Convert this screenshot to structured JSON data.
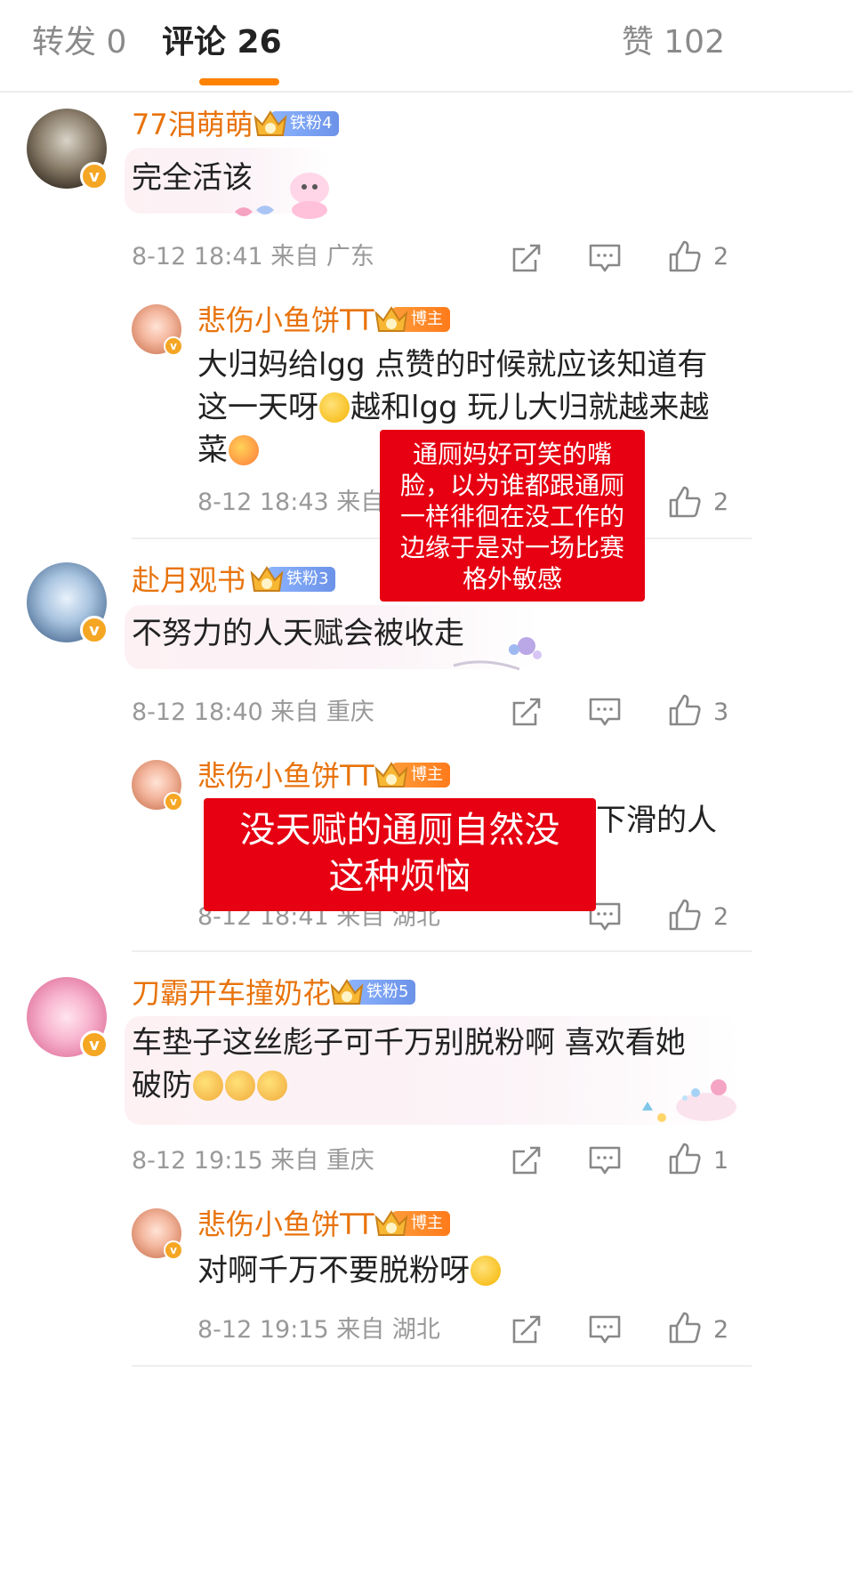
{
  "tabs": {
    "repost": "转发 0",
    "comments": "评论 26",
    "likes": "赞 102"
  },
  "comments": [
    {
      "username": "77泪萌萌",
      "badge": "铁粉4",
      "text": "完全活该",
      "time": "8-12 18:41",
      "location": "来自 广东",
      "like_count": "2",
      "reply": {
        "username": "悲伤小鱼饼TT",
        "badge": "博主",
        "text_lines": [
          "大归妈给lgg 点赞的时候就应该知道有",
          "这一天呀",
          "越和lgg 玩儿大归就越来越",
          "菜"
        ],
        "time": "8-12 18:43",
        "location": "来自",
        "like_count": "2"
      }
    },
    {
      "username": "赴月观书",
      "badge": "铁粉3",
      "text": "不努力的人天赋会被收走",
      "time": "8-12 18:40",
      "location": "来自 重庆",
      "like_count": "3",
      "reply": {
        "username": "悲伤小鱼饼TT",
        "badge": "博主",
        "text_visible_fragment": "下滑的人",
        "time": "8-12 18:41",
        "location": "来自 湖北",
        "like_count": "2"
      }
    },
    {
      "username": "刀霸开车撞奶花",
      "badge": "铁粉5",
      "text_lines": [
        "车垫子这丝彪子可千万别脱粉啊 喜欢看她",
        "破防"
      ],
      "time": "8-12 19:15",
      "location": "来自 重庆",
      "like_count": "1",
      "reply": {
        "username": "悲伤小鱼饼TT",
        "badge": "博主",
        "text": "对啊千万不要脱粉呀",
        "time": "8-12 19:15",
        "location": "来自 湖北",
        "like_count": "2"
      }
    }
  ],
  "overlays": {
    "box1_lines": [
      "通厕妈好可笑的嘴",
      "脸，以为谁都跟通厕",
      "一样徘徊在没工作的",
      "边缘于是对一场比赛",
      "格外敏感"
    ],
    "box2_lines": [
      "没天赋的通厕自然没",
      "这种烦恼"
    ]
  },
  "colors": {
    "accent": "#ff8200",
    "username": "#e8730c",
    "overlay_red": "#e60012",
    "verified": "#f5a623"
  }
}
